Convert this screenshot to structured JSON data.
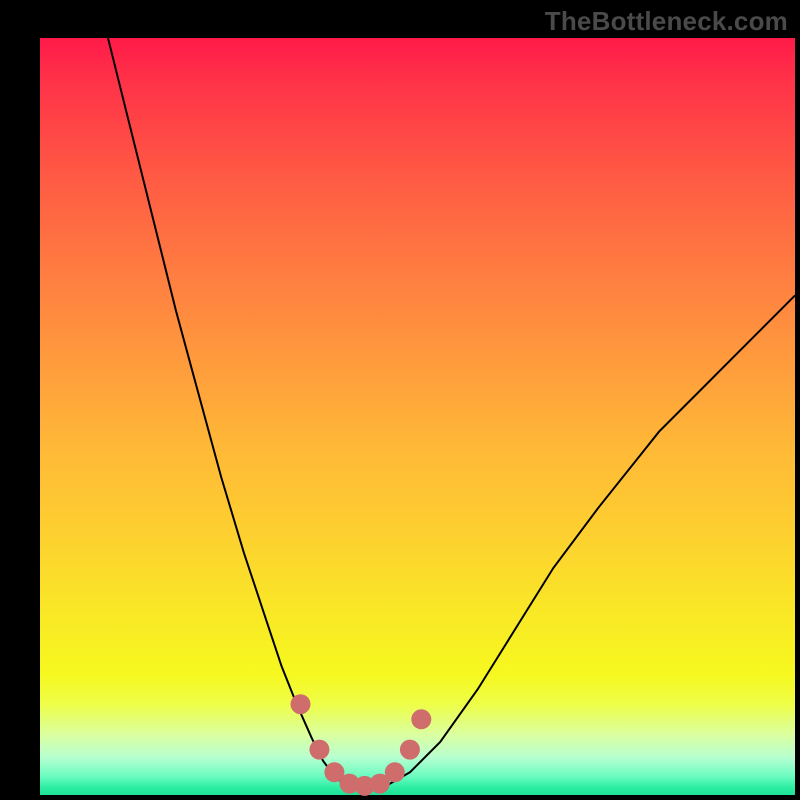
{
  "watermark": "TheBottleneck.com",
  "chart_data": {
    "type": "line",
    "title": "",
    "xlabel": "",
    "ylabel": "",
    "xlim": [
      0,
      100
    ],
    "ylim": [
      0,
      100
    ],
    "legend": false,
    "grid": false,
    "background_gradient": {
      "top": "#ff1a49",
      "bottom": "#1ce196",
      "note": "vertical gradient red → orange → yellow → green"
    },
    "series": [
      {
        "name": "bottleneck-curve",
        "color": "#000000",
        "stroke_width": 2,
        "x": [
          9,
          12,
          15,
          18,
          21,
          24,
          27,
          30,
          32,
          34,
          36,
          37.5,
          39,
          40.5,
          42,
          44,
          46,
          49,
          53,
          58,
          63,
          68,
          74,
          82,
          90,
          100
        ],
        "y": [
          100,
          88,
          76,
          64,
          53,
          42,
          32,
          23,
          17,
          12,
          7.5,
          4.5,
          2.5,
          1.3,
          1.0,
          1.0,
          1.3,
          3,
          7,
          14,
          22,
          30,
          38,
          48,
          56,
          66
        ]
      },
      {
        "name": "optimal-zone-markers",
        "type": "scatter",
        "color": "#cf6d6d",
        "marker_radius": 10,
        "x": [
          34.5,
          37,
          39,
          41,
          43,
          45,
          47,
          49,
          50.5
        ],
        "y": [
          12,
          6,
          3,
          1.5,
          1.2,
          1.5,
          3,
          6,
          10
        ]
      }
    ],
    "annotations": []
  }
}
